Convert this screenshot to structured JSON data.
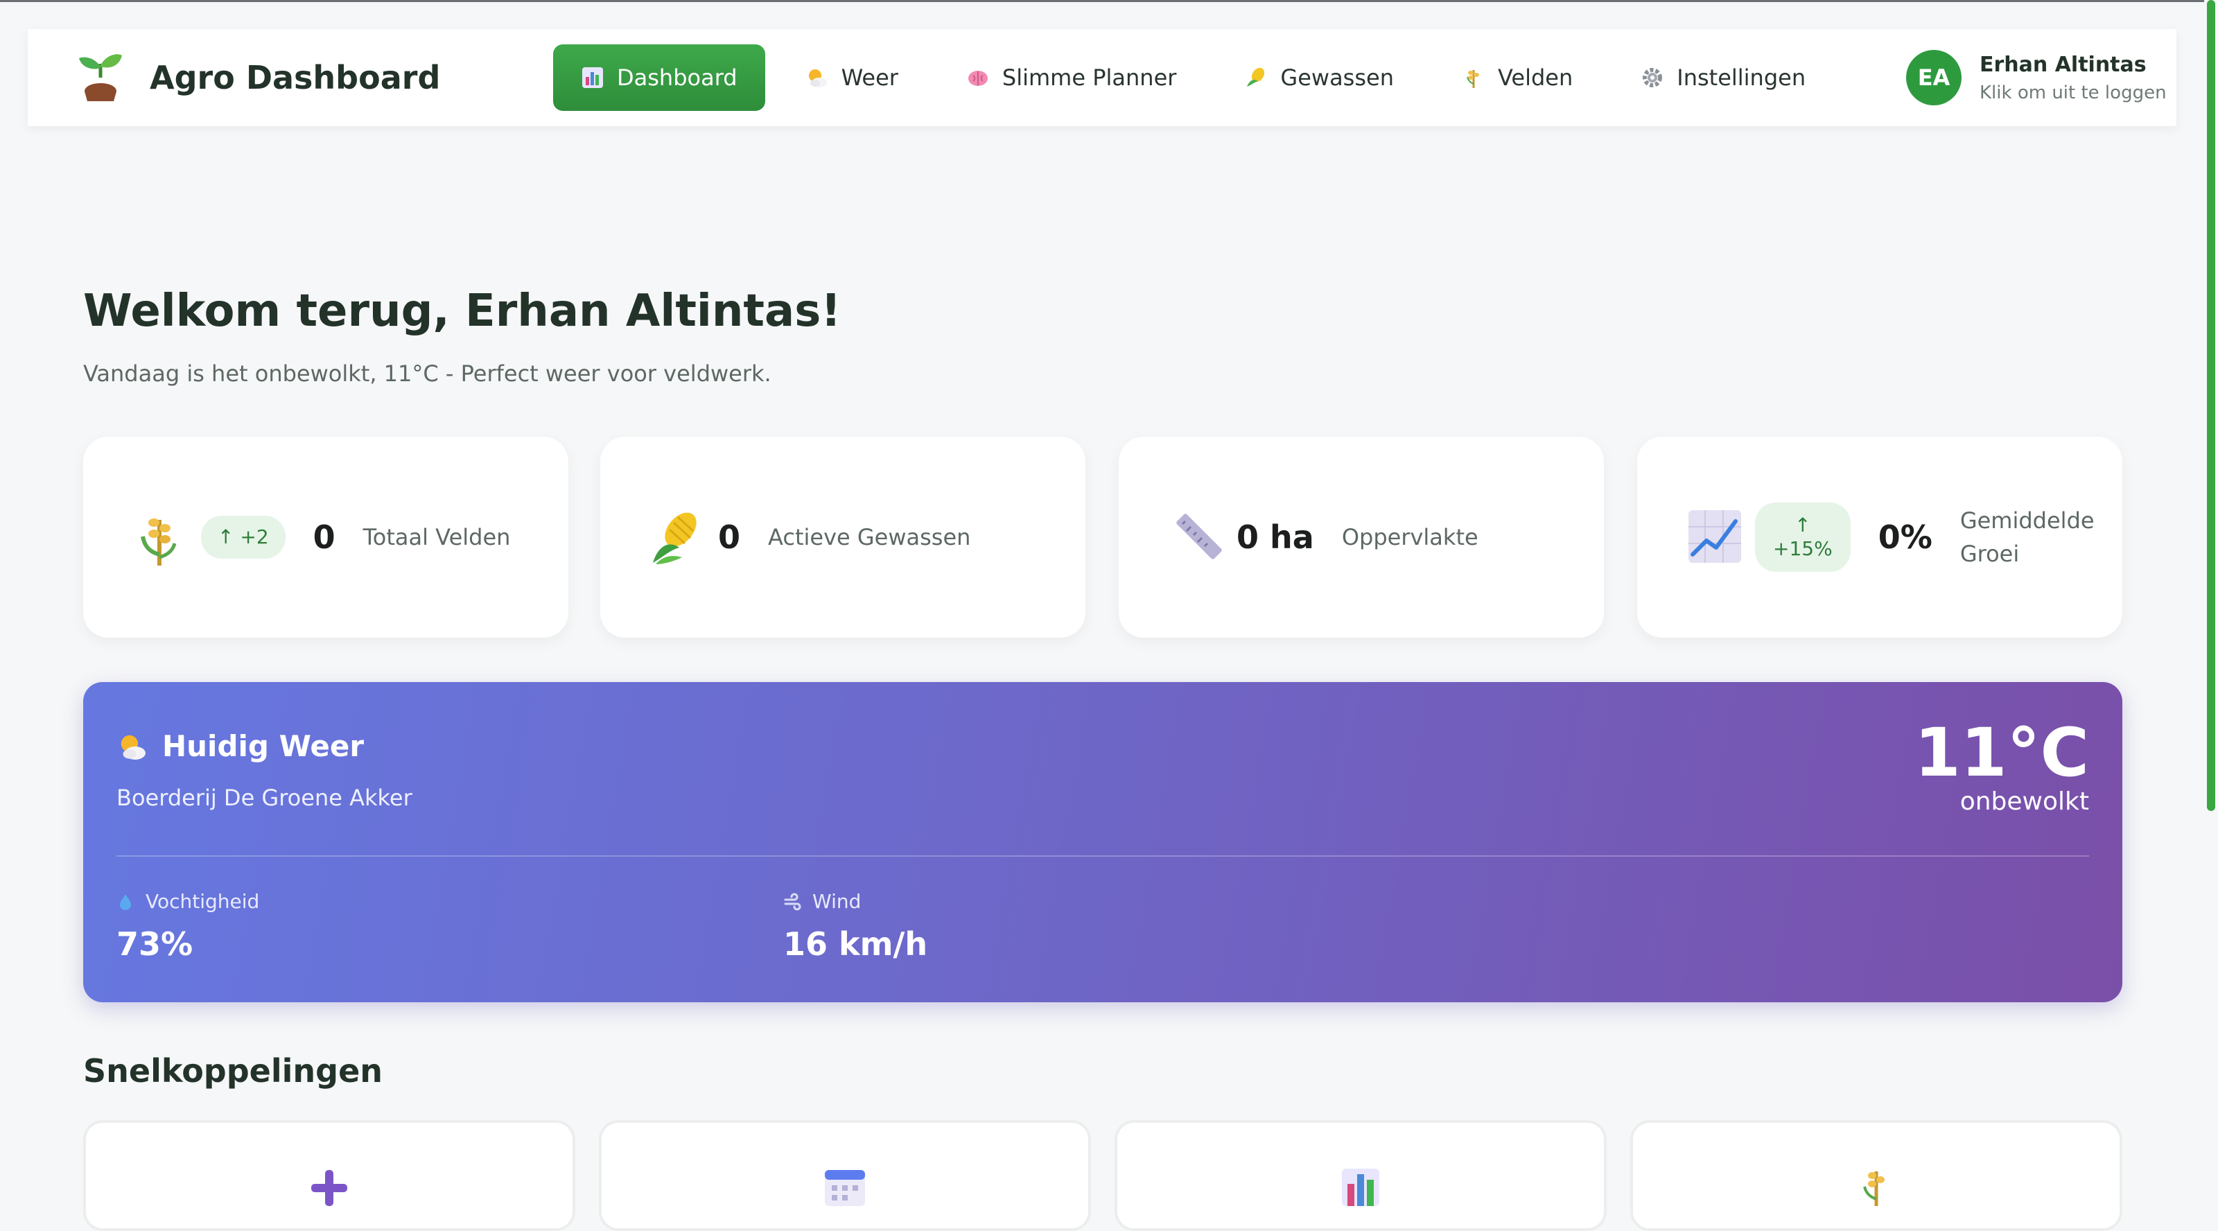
{
  "app": {
    "title": "Agro Dashboard",
    "brand_icon": "seedling-icon"
  },
  "nav": {
    "items": [
      {
        "label": "Dashboard",
        "icon": "bar-chart-icon",
        "active": true
      },
      {
        "label": "Weer",
        "icon": "sun-cloud-icon",
        "active": false
      },
      {
        "label": "Slimme Planner",
        "icon": "brain-icon",
        "active": false
      },
      {
        "label": "Gewassen",
        "icon": "corn-icon",
        "active": false
      },
      {
        "label": "Velden",
        "icon": "wheat-icon",
        "active": false
      },
      {
        "label": "Instellingen",
        "icon": "gear-icon",
        "active": false
      }
    ]
  },
  "user": {
    "initials": "EA",
    "name": "Erhan Altintas",
    "subtitle": "Klik om uit te loggen"
  },
  "welcome": {
    "title": "Welkom terug, Erhan Altintas!",
    "subtitle": "Vandaag is het onbewolkt, 11°C - Perfect weer voor veldwerk."
  },
  "stats": [
    {
      "icon": "wheat-icon",
      "badge": "↑ +2",
      "value": "0",
      "label": "Totaal Velden"
    },
    {
      "icon": "corn-icon",
      "badge": "",
      "value": "0",
      "label": "Actieve Gewassen"
    },
    {
      "icon": "ruler-icon",
      "badge": "",
      "value": "0 ha",
      "label": "Oppervlakte"
    },
    {
      "icon": "trend-chart-icon",
      "badge_arrow": "↑",
      "badge": "+15%",
      "value": "0%",
      "label_line1": "Gemiddelde",
      "label_line2": "Groei"
    }
  ],
  "weather": {
    "icon": "sun-cloud-icon",
    "title": "Huidig Weer",
    "location": "Boerderij De Groene Akker",
    "temperature": "11°C",
    "condition": "onbewolkt",
    "humidity_label": "Vochtigheid",
    "humidity_value": "73%",
    "humidity_icon": "droplet-icon",
    "wind_label": "Wind",
    "wind_value": "16 km/h",
    "wind_icon": "wind-icon",
    "gradient_start": "#6678e0",
    "gradient_end": "#7a4fa8"
  },
  "quick_links": {
    "title": "Snelkoppelingen",
    "items": [
      {
        "icon": "plus-icon"
      },
      {
        "icon": "calendar-icon"
      },
      {
        "icon": "bar-chart-icon"
      },
      {
        "icon": "wheat-icon"
      }
    ]
  },
  "colors": {
    "accent": "#2e9a3e",
    "badge_bg": "#e6f4e8",
    "badge_text": "#2e7d3a"
  }
}
